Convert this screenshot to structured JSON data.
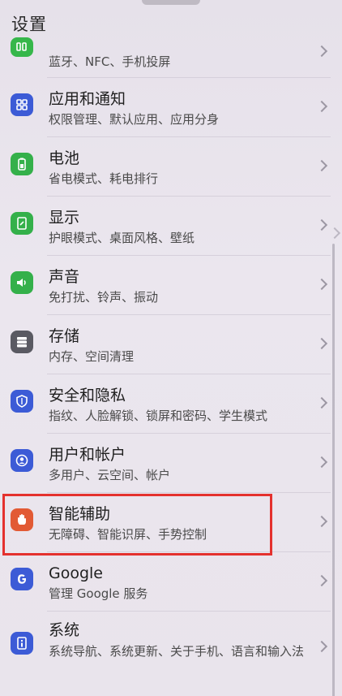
{
  "header": {
    "title": "设置"
  },
  "items": [
    {
      "icon": "wireless-projection-icon",
      "label": "",
      "sub": "蓝牙、NFC、手机投屏",
      "color": "#36b74a"
    },
    {
      "icon": "apps-grid-icon",
      "label": "应用和通知",
      "sub": "权限管理、默认应用、应用分身",
      "color": "#3c5bd6"
    },
    {
      "icon": "battery-icon",
      "label": "电池",
      "sub": "省电模式、耗电排行",
      "color": "#34b04a"
    },
    {
      "icon": "display-icon",
      "label": "显示",
      "sub": "护眼模式、桌面风格、壁纸",
      "color": "#34b04a"
    },
    {
      "icon": "speaker-icon",
      "label": "声音",
      "sub": "免打扰、铃声、振动",
      "color": "#34b04a"
    },
    {
      "icon": "storage-icon",
      "label": "存储",
      "sub": "内存、空间清理",
      "color": "#5a5a62"
    },
    {
      "icon": "shield-icon",
      "label": "安全和隐私",
      "sub": "指纹、人脸解锁、锁屏和密码、学生模式",
      "color": "#3c5bd6"
    },
    {
      "icon": "user-icon",
      "label": "用户和帐户",
      "sub": "多用户、云空间、帐户",
      "color": "#3c5bd6"
    },
    {
      "icon": "hand-icon",
      "label": "智能辅助",
      "sub": "无障碍、智能识屏、手势控制",
      "color": "#e25a34"
    },
    {
      "icon": "google-icon",
      "label": "Google",
      "sub": "管理 Google 服务",
      "color": "#3c5bd6"
    },
    {
      "icon": "system-info-icon",
      "label": "系统",
      "sub": "系统导航、系统更新、关于手机、语言和输入法",
      "color": "#3c5bd6"
    }
  ],
  "colors": {
    "highlight": "#e4312e",
    "background": "#e9e4ec"
  }
}
